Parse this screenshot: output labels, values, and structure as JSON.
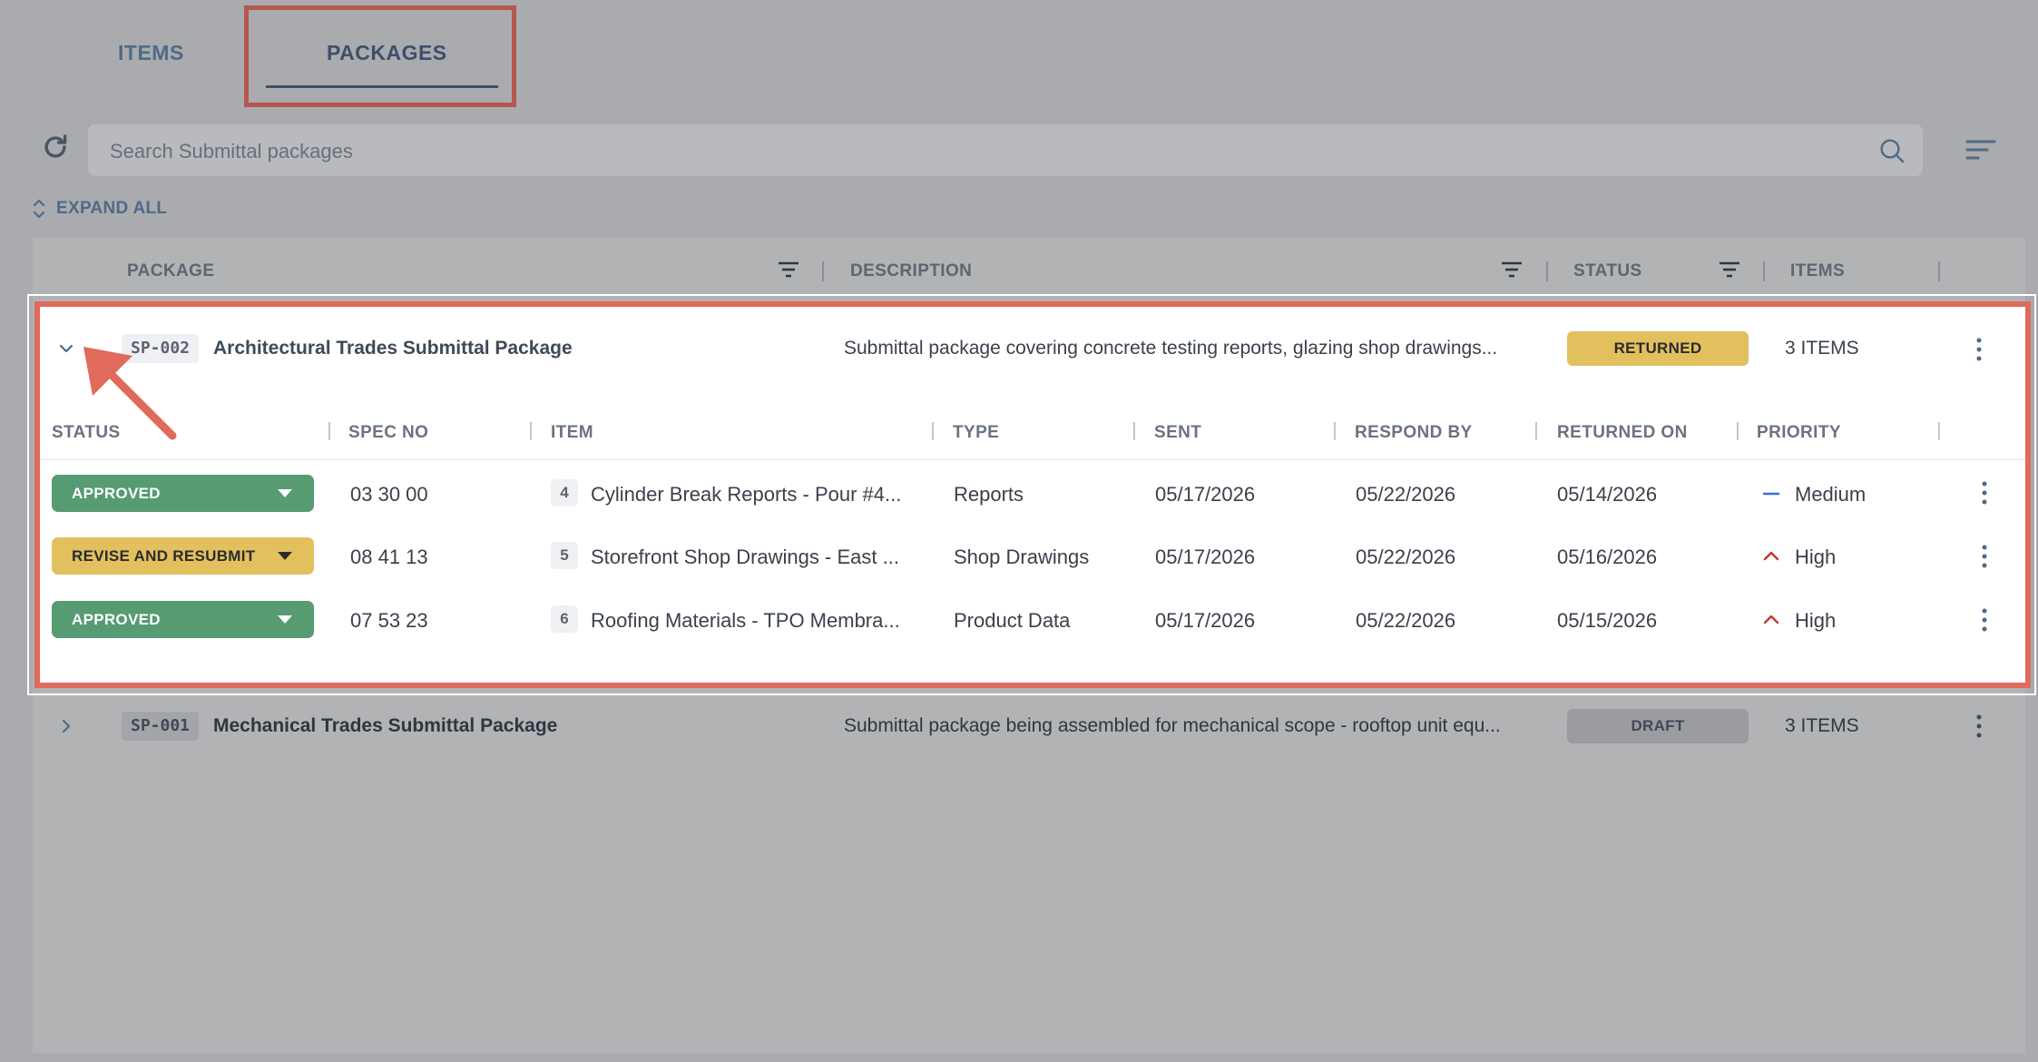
{
  "tabs": {
    "items": "ITEMS",
    "packages": "PACKAGES"
  },
  "search": {
    "placeholder": "Search Submittal packages"
  },
  "expand_all": "EXPAND ALL",
  "columns": {
    "package": "PACKAGE",
    "description": "DESCRIPTION",
    "status": "STATUS",
    "items": "ITEMS"
  },
  "packages": [
    {
      "id": "SP-002",
      "title": "Architectural Trades Submittal Package",
      "description": "Submittal package covering concrete testing reports, glazing shop drawings...",
      "status": "RETURNED",
      "items_count": "3 ITEMS",
      "expanded": true
    },
    {
      "id": "SP-001",
      "title": "Mechanical Trades Submittal Package",
      "description": "Submittal package being assembled for mechanical scope - rooftop unit equ...",
      "status": "DRAFT",
      "items_count": "3 ITEMS",
      "expanded": false
    }
  ],
  "sub_columns": {
    "status": "STATUS",
    "spec_no": "SPEC NO",
    "item": "ITEM",
    "type": "TYPE",
    "sent": "SENT",
    "respond_by": "RESPOND BY",
    "returned_on": "RETURNED ON",
    "priority": "PRIORITY"
  },
  "sub_rows": [
    {
      "status": "APPROVED",
      "spec_no": "03 30 00",
      "num": "4",
      "item": "Cylinder Break Reports - Pour #4...",
      "type": "Reports",
      "sent": "05/17/2026",
      "respond_by": "05/22/2026",
      "returned_on": "05/14/2026",
      "priority": "Medium"
    },
    {
      "status": "REVISE AND RESUBMIT",
      "spec_no": "08 41 13",
      "num": "5",
      "item": "Storefront Shop Drawings - East ...",
      "type": "Shop Drawings",
      "sent": "05/17/2026",
      "respond_by": "05/22/2026",
      "returned_on": "05/16/2026",
      "priority": "High"
    },
    {
      "status": "APPROVED",
      "spec_no": "07 53 23",
      "num": "6",
      "item": "Roofing Materials - TPO Membra...",
      "type": "Product Data",
      "sent": "05/17/2026",
      "respond_by": "05/22/2026",
      "returned_on": "05/15/2026",
      "priority": "High"
    }
  ],
  "colors": {
    "approved": "#569b72",
    "revise": "#e2c05e",
    "returned": "#e2c05e",
    "draft": "#9a9c9f",
    "highlight": "#e06a5b",
    "priority_high": "#c0392b",
    "priority_medium": "#3b6fd4"
  }
}
